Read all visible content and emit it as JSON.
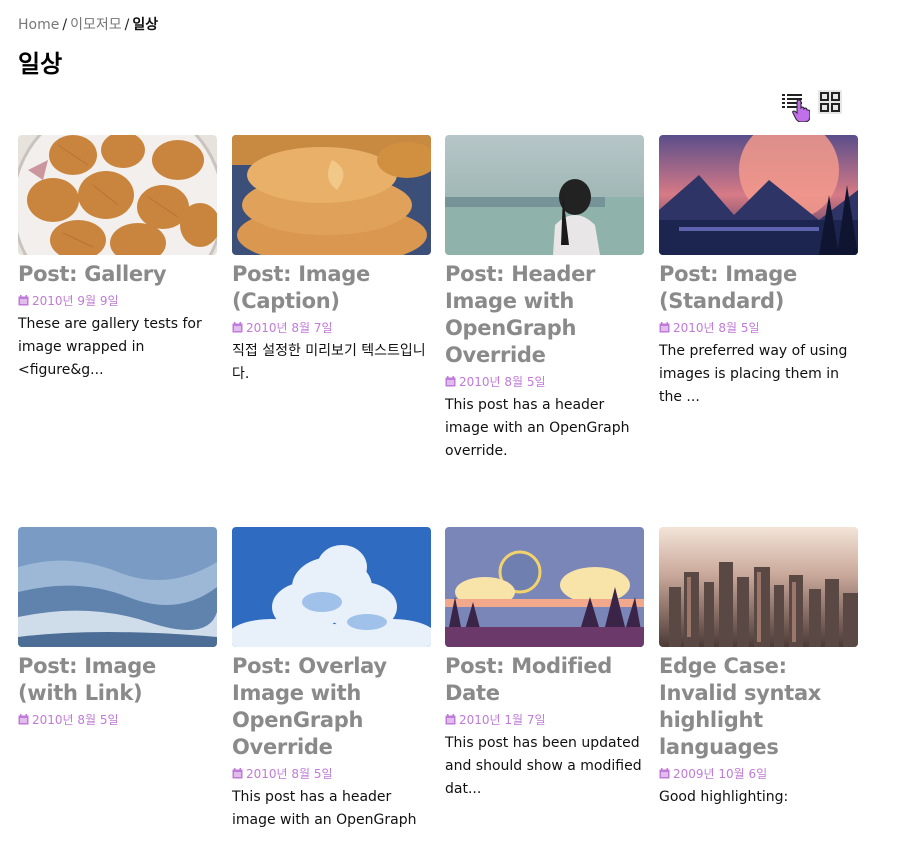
{
  "breadcrumb": {
    "home": "Home",
    "category": "이모저모",
    "current": "일상"
  },
  "page_title": "일상",
  "view_toggle": {
    "list_icon": "list-icon",
    "grid_icon": "grid-icon"
  },
  "colors": {
    "title": "#8a8a8a",
    "date": "#c07ad8",
    "text": "#111111"
  },
  "posts": [
    {
      "title": "Post: Gallery",
      "date": "2010년 9월 9일",
      "excerpt": "These are gallery tests for image wrapped in <figure&g...",
      "thumb": "cookies-plate"
    },
    {
      "title": "Post: Image (Caption)",
      "date": "2010년 8월 7일",
      "excerpt": "직접 설정한 미리보기 텍스트입니다.",
      "thumb": "cookies-stack"
    },
    {
      "title": "Post: Header Image with OpenGraph Override",
      "date": "2010년 8월 5일",
      "excerpt": "This post has a header image with an OpenGraph override.",
      "thumb": "sea-woman"
    },
    {
      "title": "Post: Image (Standard)",
      "date": "2010년 8월 5일",
      "excerpt": "The preferred way of using images is placing them in the ...",
      "thumb": "mountain-sunset"
    },
    {
      "title": "Post: Image (with Link)",
      "date": "2010년 8월 5일",
      "excerpt": "",
      "thumb": "foggy-mountains"
    },
    {
      "title": "Post: Overlay Image with OpenGraph Override",
      "date": "2010년 8월 5일",
      "excerpt": "This post has a header image with an OpenGraph",
      "thumb": "clouds-sky"
    },
    {
      "title": "Post: Modified Date",
      "date": "2010년 1월 7일",
      "excerpt": "This post has been updated and should show a modified dat...",
      "thumb": "moon-forest"
    },
    {
      "title": "Edge Case: Invalid syntax highlight languages",
      "date": "2009년 10월 6일",
      "excerpt": "Good highlighting:",
      "thumb": "city-skyline"
    }
  ]
}
